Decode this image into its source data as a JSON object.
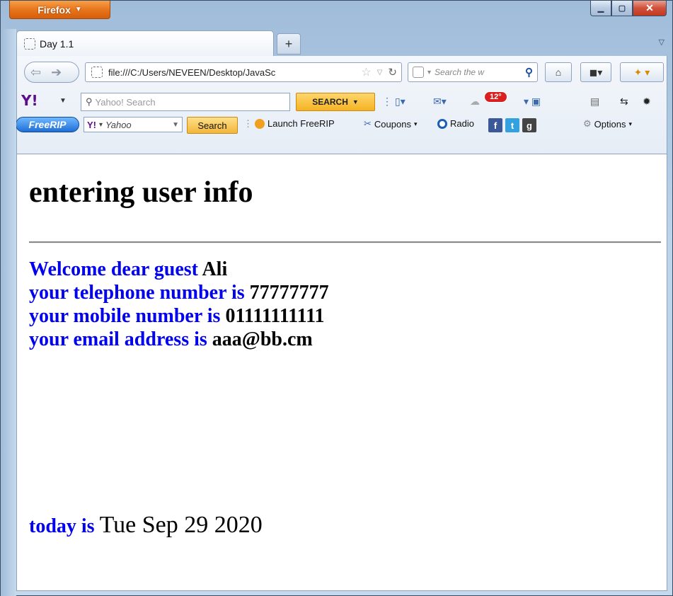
{
  "browser": {
    "app_button": "Firefox",
    "tab_title": "Day 1.1",
    "url": "file:///C:/Users/NEVEEN/Desktop/JavaSc",
    "search_placeholder": "Search the w",
    "yahoo_search_placeholder": "Yahoo! Search",
    "yahoo_search_button": "SEARCH",
    "weather_badge": "12°",
    "freerip_logo": "FreeRIP",
    "freerip_yahoo_field": "Yahoo",
    "freerip_search_button": "Search",
    "launch_label": "Launch FreeRIP",
    "coupons_label": "Coupons",
    "radio_label": "Radio",
    "options_label": "Options"
  },
  "page": {
    "title": "entering user info",
    "welcome_label": "Welcome dear guest ",
    "welcome_value": "Ali",
    "telephone_label": "your telephone number is ",
    "telephone_value": "77777777",
    "mobile_label": "your mobile number is ",
    "mobile_value": "01111111111",
    "email_label": "your email address is ",
    "email_value": "aaa@bb.cm",
    "today_label": "today is ",
    "today_value": "Tue Sep 29 2020"
  },
  "colors": {
    "label_blue": "#0000ee",
    "firefox_orange": "#e8761c"
  }
}
